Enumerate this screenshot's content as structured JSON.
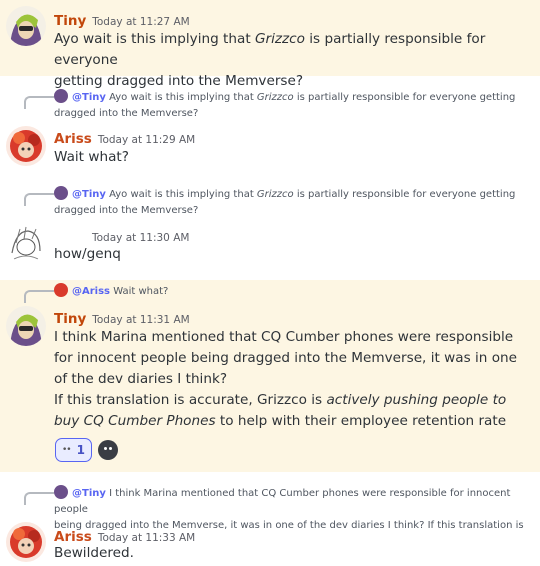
{
  "colors": {
    "tiny": "#c1460a",
    "ariss": "#c94b1b",
    "mention": "#5865f2",
    "highlight": "#fdf6e3"
  },
  "messages": [
    {
      "author": "Tiny",
      "time": "Today at 11:27 AM",
      "lines": [
        "Ayo wait is this implying that ",
        "Grizzco",
        " is partially responsible for everyone",
        "getting dragged into the Memverse?"
      ]
    },
    {
      "reply": {
        "mention": "@Tiny",
        "text_a": " Ayo wait is this implying that ",
        "italic": "Grizzco",
        "text_b": " is partially responsible for everyone getting",
        "text_c": "dragged into the Memverse?"
      },
      "author": "Ariss",
      "time": "Today at 11:29 AM",
      "text": "Wait what?"
    },
    {
      "reply": {
        "mention": "@Tiny",
        "text_a": " Ayo wait is this implying that ",
        "italic": "Grizzco",
        "text_b": " is partially responsible for everyone getting",
        "text_c": "dragged into the Memverse?"
      },
      "time": "Today at 11:30 AM",
      "text": "how/genq"
    },
    {
      "reply": {
        "mention": "@Ariss",
        "text": " Wait what?"
      },
      "author": "Tiny",
      "time": "Today at 11:31 AM",
      "para1": "I think Marina mentioned that CQ Cumber phones were responsible for innocent people being dragged into the Memverse, it was in one of the dev diaries I think?",
      "para2a": "If this translation is accurate, Grizzco is ",
      "para2b": "actively pushing people to buy CQ Cumber Phones",
      "para2c": " to help with their employee retention rate",
      "reaction": {
        "emoji": "••",
        "count": "1"
      }
    },
    {
      "reply": {
        "mention": "@Tiny",
        "text": " I think Marina mentioned that CQ Cumber phones were responsible for innocent people",
        "text_c": "being dragged into the Memverse, it was in one of the dev diaries I think? If this translation is"
      },
      "author": "Ariss",
      "time": "Today at 11:33 AM",
      "text": "Bewildered."
    }
  ]
}
